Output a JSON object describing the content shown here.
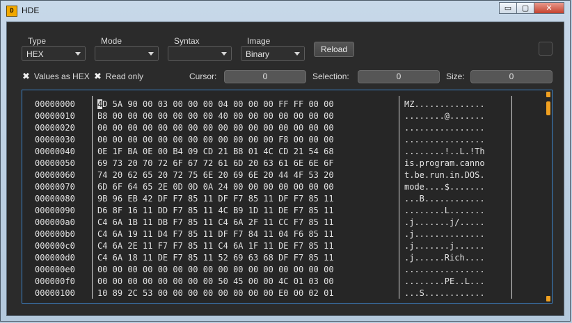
{
  "window": {
    "title": "HDE",
    "icon_text": "D",
    "min_label": "▭",
    "max_label": "▢",
    "close_label": "✕"
  },
  "toolbar": {
    "type": {
      "label": "Type",
      "value": "HEX"
    },
    "mode": {
      "label": "Mode",
      "value": ""
    },
    "syntax": {
      "label": "Syntax",
      "value": ""
    },
    "image": {
      "label": "Image",
      "value": "Binary"
    },
    "reload_label": "Reload"
  },
  "options": {
    "values_as_hex": {
      "label": "Values as HEX",
      "checked": true
    },
    "read_only": {
      "label": "Read only",
      "checked": true
    }
  },
  "status": {
    "cursor": {
      "label": "Cursor:",
      "value": "0"
    },
    "selection": {
      "label": "Selection:",
      "value": "0"
    },
    "size": {
      "label": "Size:",
      "value": "0"
    }
  },
  "hex": {
    "rows": [
      {
        "offset": "00000000",
        "bytes": "4D 5A 90 00 03 00 00 00 04 00 00 00 FF FF 00 00",
        "ascii": "MZ.............."
      },
      {
        "offset": "00000010",
        "bytes": "B8 00 00 00 00 00 00 00 40 00 00 00 00 00 00 00",
        "ascii": "........@......."
      },
      {
        "offset": "00000020",
        "bytes": "00 00 00 00 00 00 00 00 00 00 00 00 00 00 00 00",
        "ascii": "................"
      },
      {
        "offset": "00000030",
        "bytes": "00 00 00 00 00 00 00 00 00 00 00 00 F8 00 00 00",
        "ascii": "................"
      },
      {
        "offset": "00000040",
        "bytes": "0E 1F BA 0E 00 B4 09 CD 21 B8 01 4C CD 21 54 68",
        "ascii": "........!..L.!Th"
      },
      {
        "offset": "00000050",
        "bytes": "69 73 20 70 72 6F 67 72 61 6D 20 63 61 6E 6E 6F",
        "ascii": "is.program.canno"
      },
      {
        "offset": "00000060",
        "bytes": "74 20 62 65 20 72 75 6E 20 69 6E 20 44 4F 53 20",
        "ascii": "t.be.run.in.DOS."
      },
      {
        "offset": "00000070",
        "bytes": "6D 6F 64 65 2E 0D 0D 0A 24 00 00 00 00 00 00 00",
        "ascii": "mode....$......."
      },
      {
        "offset": "00000080",
        "bytes": "9B 96 EB 42 DF F7 85 11 DF F7 85 11 DF F7 85 11",
        "ascii": "...B............"
      },
      {
        "offset": "00000090",
        "bytes": "D6 8F 16 11 DD F7 85 11 4C B9 1D 11 DE F7 85 11",
        "ascii": "........L......."
      },
      {
        "offset": "000000a0",
        "bytes": "C4 6A 1B 11 DB F7 85 11 C4 6A 2F 11 CC F7 85 11",
        "ascii": ".j.......j/....."
      },
      {
        "offset": "000000b0",
        "bytes": "C4 6A 19 11 D4 F7 85 11 DF F7 84 11 04 F6 85 11",
        "ascii": ".j.............."
      },
      {
        "offset": "000000c0",
        "bytes": "C4 6A 2E 11 F7 F7 85 11 C4 6A 1F 11 DE F7 85 11",
        "ascii": ".j.......j......"
      },
      {
        "offset": "000000d0",
        "bytes": "C4 6A 18 11 DE F7 85 11 52 69 63 68 DF F7 85 11",
        "ascii": ".j......Rich...."
      },
      {
        "offset": "000000e0",
        "bytes": "00 00 00 00 00 00 00 00 00 00 00 00 00 00 00 00",
        "ascii": "................"
      },
      {
        "offset": "000000f0",
        "bytes": "00 00 00 00 00 00 00 00 50 45 00 00 4C 01 03 00",
        "ascii": "........PE..L..."
      },
      {
        "offset": "00000100",
        "bytes": "10 89 2C 53 00 00 00 00 00 00 00 00 E0 00 02 01",
        "ascii": "...S............"
      }
    ]
  }
}
